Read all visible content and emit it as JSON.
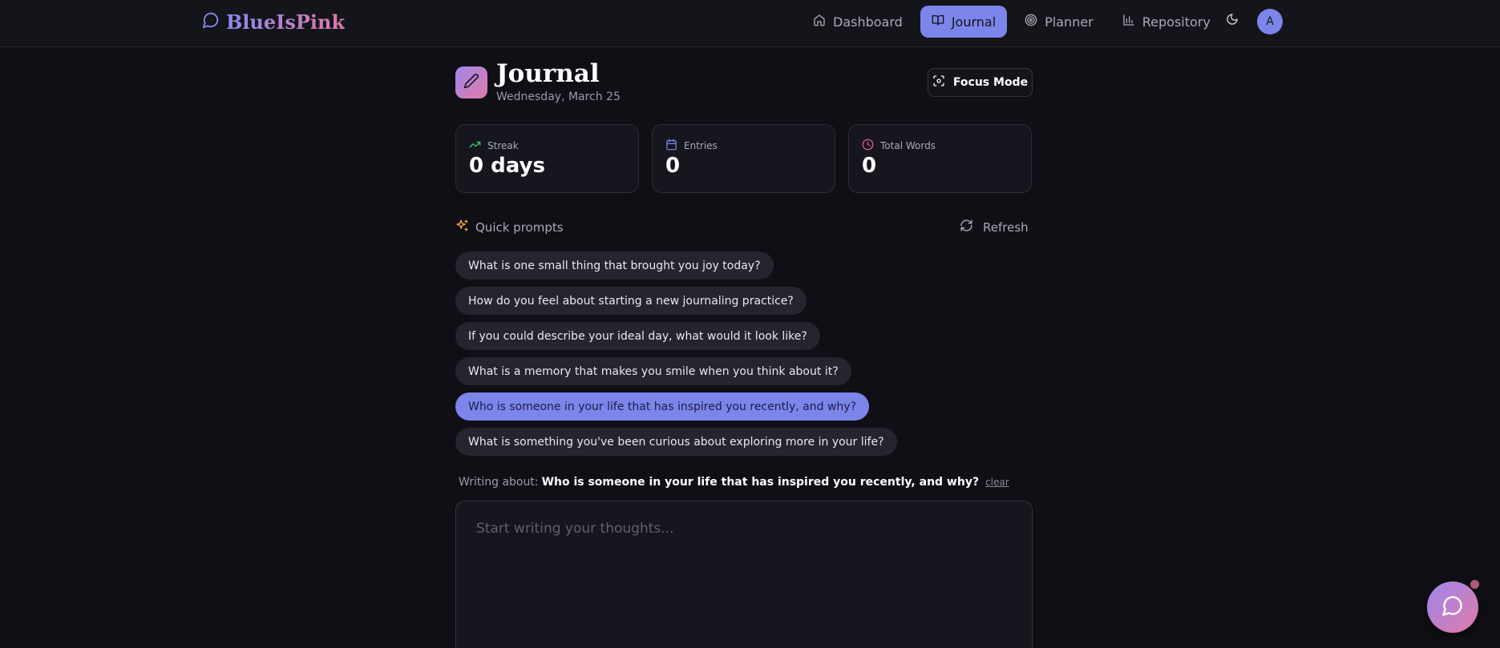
{
  "brand": {
    "name": "BlueIsPink"
  },
  "nav": {
    "items": [
      {
        "label": "Dashboard",
        "icon": "home-icon"
      },
      {
        "label": "Journal",
        "icon": "book-icon",
        "active": true
      },
      {
        "label": "Planner",
        "icon": "target-icon"
      },
      {
        "label": "Repository",
        "icon": "bar-chart-icon"
      }
    ],
    "avatar_initial": "A"
  },
  "header": {
    "title": "Journal",
    "date": "Wednesday, March 25",
    "focus_mode_label": "Focus Mode"
  },
  "stats": [
    {
      "label": "Streak",
      "value": "0 days",
      "icon": "trending-up-icon",
      "color": "#3ecf6e"
    },
    {
      "label": "Entries",
      "value": "0",
      "icon": "calendar-icon",
      "color": "#7c85ea"
    },
    {
      "label": "Total Words",
      "value": "0",
      "icon": "clock-icon",
      "color": "#e0608e"
    }
  ],
  "prompts": {
    "label": "Quick prompts",
    "refresh_label": "Refresh",
    "items": [
      "What is one small thing that brought you joy today?",
      "How do you feel about starting a new journaling practice?",
      "If you could describe your ideal day, what would it look like?",
      "What is a memory that makes you smile when you think about it?",
      "Who is someone in your life that has inspired you recently, and why?",
      "What is something you've been curious about exploring more in your life?"
    ],
    "selected_index": 4
  },
  "writing": {
    "prefix": "Writing about:",
    "topic": "Who is someone in your life that has inspired you recently, and why?",
    "clear_label": "clear",
    "placeholder": "Start writing your thoughts...",
    "value": ""
  },
  "colors": {
    "accent": "#7c85ea",
    "background": "#0f0f15",
    "brand_gradient_start": "#8b88f0",
    "brand_gradient_end": "#e07aa8"
  }
}
